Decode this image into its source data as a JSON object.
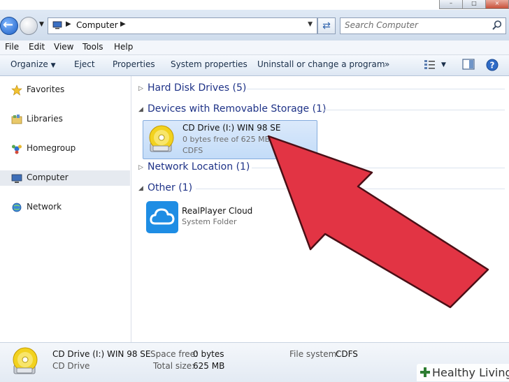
{
  "window": {
    "controls": [
      "minimize-icon",
      "maximize-icon",
      "close-icon"
    ]
  },
  "address": {
    "location": "Computer",
    "search_placeholder": "Search Computer"
  },
  "menu": [
    "File",
    "Edit",
    "View",
    "Tools",
    "Help"
  ],
  "toolbar": {
    "organize": "Organize",
    "eject": "Eject",
    "properties": "Properties",
    "system_properties": "System properties",
    "uninstall": "Uninstall or change a program",
    "more": "»"
  },
  "sidebar": {
    "items": [
      {
        "label": "Favorites",
        "icon": "star-icon"
      },
      {
        "label": "Libraries",
        "icon": "library-icon"
      },
      {
        "label": "Homegroup",
        "icon": "homegroup-icon"
      },
      {
        "label": "Computer",
        "icon": "computer-icon",
        "selected": true
      },
      {
        "label": "Network",
        "icon": "network-icon"
      }
    ]
  },
  "groups": [
    {
      "title": "Hard Disk Drives (5)",
      "expanded": false
    },
    {
      "title": "Devices with Removable Storage (1)",
      "expanded": true
    },
    {
      "title": "Network Location (1)",
      "expanded": false
    },
    {
      "title": "Other (1)",
      "expanded": true
    }
  ],
  "cd_drive": {
    "name": "CD Drive (I:) WIN 98 SE",
    "space": "0 bytes free of 625 MB",
    "fs": "CDFS"
  },
  "cloud": {
    "name": "RealPlayer Cloud",
    "type": "System Folder"
  },
  "details": {
    "name": "CD Drive (I:) WIN 98 SE",
    "type": "CD Drive",
    "space_free_label": "Space free:",
    "space_free": "0 bytes",
    "total_size_label": "Total size:",
    "total_size": "625 MB",
    "fs_label": "File system:",
    "fs": "CDFS"
  },
  "watermark": "Healthy Living",
  "colors": {
    "arrow": "#e23444",
    "selection": "#cfe3fa",
    "group_title": "#1e3287"
  }
}
